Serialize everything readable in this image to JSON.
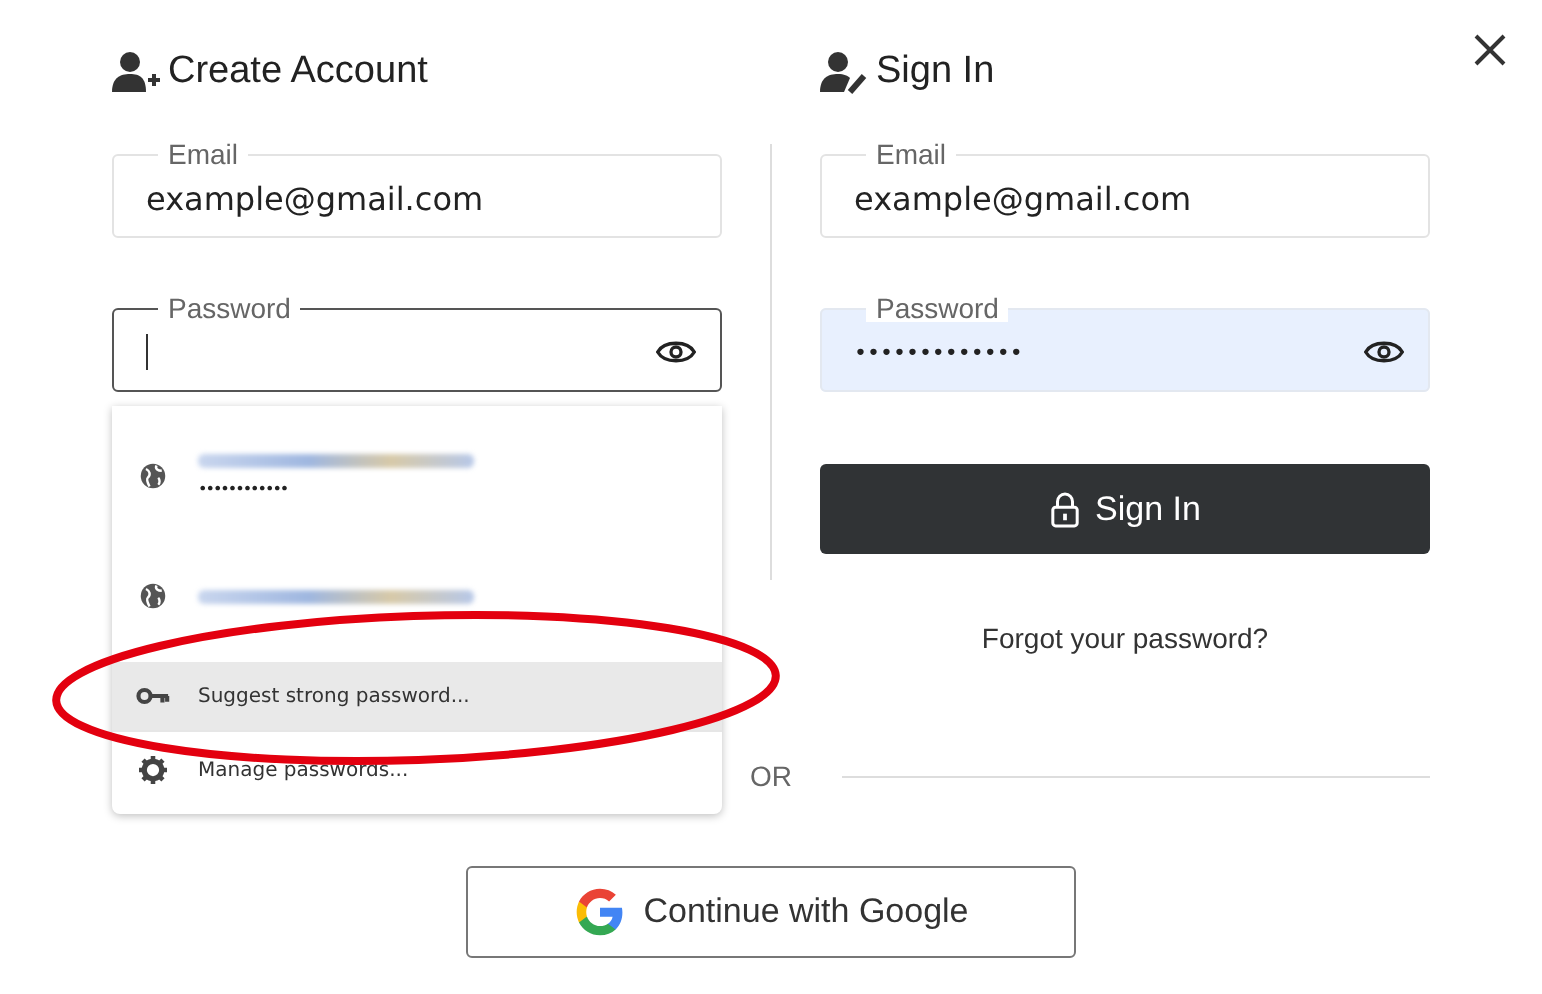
{
  "create_account": {
    "title": "Create Account",
    "email": {
      "label": "Email",
      "value": "example@gmail.com",
      "focused": false,
      "autofilled": false
    },
    "password": {
      "label": "Password",
      "focused": true,
      "autofilled": false
    }
  },
  "password_menu": {
    "items": [
      {
        "kind": "saved_login",
        "mask": "••••••••••••",
        "selected": false
      },
      {
        "kind": "saved_login",
        "selected": false
      },
      {
        "kind": "suggest",
        "label": "Suggest strong password...",
        "selected": true
      },
      {
        "kind": "manage",
        "label": "Manage passwords...",
        "selected": false
      }
    ]
  },
  "sign_in": {
    "title": "Sign In",
    "email": {
      "label": "Email",
      "value": "example@gmail.com",
      "focused": false,
      "autofilled": false
    },
    "password": {
      "label": "Password",
      "value": "•••••••••••••",
      "focused": false,
      "autofilled": true
    },
    "button": "Sign In",
    "forgot_link": "Forgot your password?"
  },
  "divider_text": "OR",
  "google_button": "Continue with Google"
}
